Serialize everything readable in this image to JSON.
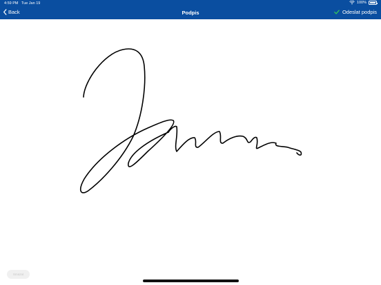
{
  "status_bar": {
    "time": "4:59 PM",
    "date": "Tue Jan 19",
    "battery": "100%"
  },
  "nav": {
    "back_label": "Back",
    "title": "Podpis",
    "send_label": "Odeslat podpis"
  },
  "canvas": {
    "clear_label": "Smazat"
  },
  "colors": {
    "bar": "#0a4ea0",
    "accent_check": "#34c759",
    "ink": "#000000"
  },
  "icons": [
    "back-chevron-icon",
    "wifi-icon",
    "battery-icon",
    "checkmark-icon"
  ]
}
